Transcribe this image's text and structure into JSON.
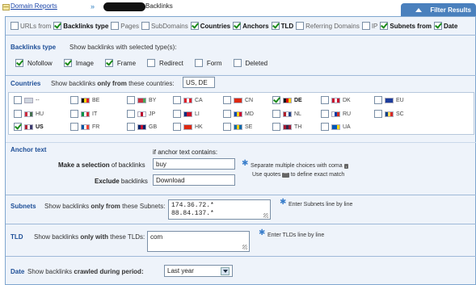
{
  "breadcrumb": {
    "root": "Domain Reports",
    "separator": "»",
    "current": "Backlinks"
  },
  "filter_tab": {
    "label": "Filter Results"
  },
  "columns": [
    {
      "label": "URLs from",
      "checked": false,
      "bold": false
    },
    {
      "label": "Backlinks type",
      "checked": true,
      "bold": true
    },
    {
      "label": "Pages",
      "checked": false,
      "bold": false
    },
    {
      "label": "SubDomains",
      "checked": false,
      "bold": false
    },
    {
      "label": "Countries",
      "checked": true,
      "bold": true
    },
    {
      "label": "Anchors",
      "checked": true,
      "bold": true
    },
    {
      "label": "TLD",
      "checked": true,
      "bold": true
    },
    {
      "label": "Referring Domains",
      "checked": false,
      "bold": false
    },
    {
      "label": "IP",
      "checked": false,
      "bold": false
    },
    {
      "label": "Subnets from",
      "checked": true,
      "bold": true
    },
    {
      "label": "Date",
      "checked": true,
      "bold": true
    }
  ],
  "backlinks_type": {
    "title": "Backlinks type",
    "description": "Show backlinks with selected type(s):",
    "options": [
      {
        "label": "Nofollow",
        "checked": true
      },
      {
        "label": "Image",
        "checked": true
      },
      {
        "label": "Frame",
        "checked": true
      },
      {
        "label": "Redirect",
        "checked": false
      },
      {
        "label": "Form",
        "checked": false
      },
      {
        "label": "Deleted",
        "checked": false
      }
    ]
  },
  "countries": {
    "title": "Countries",
    "desc_prefix": "Show backlinks",
    "desc_bold": "only from",
    "desc_suffix": "these countries:",
    "value": "US, DE",
    "items": [
      {
        "code": "--",
        "checked": false,
        "flag": [
          "#cfd6e0",
          "#cfd6e0",
          "#cfd6e0"
        ]
      },
      {
        "code": "BE",
        "checked": false,
        "flag": [
          "#111",
          "#f5d400",
          "#e0202a"
        ]
      },
      {
        "code": "BY",
        "checked": false,
        "flag": [
          "#c8313e",
          "#c8313e",
          "#4aa657"
        ]
      },
      {
        "code": "CA",
        "checked": false,
        "flag": [
          "#e0202a",
          "#fff",
          "#e0202a"
        ]
      },
      {
        "code": "CN",
        "checked": false,
        "flag": [
          "#de2910",
          "#de2910",
          "#de2910"
        ]
      },
      {
        "code": "DE",
        "checked": true,
        "flag": [
          "#111",
          "#dd0000",
          "#ffce00"
        ]
      },
      {
        "code": "DK",
        "checked": false,
        "flag": [
          "#c8102e",
          "#fff",
          "#c8102e"
        ]
      },
      {
        "code": "EU",
        "checked": false,
        "flag": [
          "#1c3c9c",
          "#1c3c9c",
          "#1c3c9c"
        ]
      },
      {
        "code": "HU",
        "checked": false,
        "flag": [
          "#cd2a3e",
          "#fff",
          "#436f4d"
        ]
      },
      {
        "code": "IT",
        "checked": false,
        "flag": [
          "#009246",
          "#fff",
          "#ce2b37"
        ]
      },
      {
        "code": "JP",
        "checked": false,
        "flag": [
          "#fff",
          "#bc002d",
          "#fff"
        ]
      },
      {
        "code": "LI",
        "checked": false,
        "flag": [
          "#002b7f",
          "#ce1126",
          "#ce1126"
        ]
      },
      {
        "code": "MD",
        "checked": false,
        "flag": [
          "#0046ae",
          "#ffd200",
          "#cc092f"
        ]
      },
      {
        "code": "NL",
        "checked": false,
        "flag": [
          "#ae1c28",
          "#fff",
          "#21468b"
        ]
      },
      {
        "code": "RU",
        "checked": false,
        "flag": [
          "#fff",
          "#0039a6",
          "#d52b1e"
        ]
      },
      {
        "code": "SC",
        "checked": false,
        "flag": [
          "#003f87",
          "#fcd856",
          "#d62828"
        ]
      },
      {
        "code": "US",
        "checked": true,
        "flag": [
          "#b22234",
          "#fff",
          "#3c3b6e"
        ]
      },
      {
        "code": "FR",
        "checked": false,
        "flag": [
          "#0055a4",
          "#fff",
          "#ef4135"
        ]
      },
      {
        "code": "GB",
        "checked": false,
        "flag": [
          "#012169",
          "#c8102e",
          "#012169"
        ]
      },
      {
        "code": "HK",
        "checked": false,
        "flag": [
          "#de2910",
          "#de2910",
          "#de2910"
        ]
      },
      {
        "code": "SE",
        "checked": false,
        "flag": [
          "#006aa7",
          "#fecc00",
          "#006aa7"
        ]
      },
      {
        "code": "TH",
        "checked": false,
        "flag": [
          "#a51931",
          "#2d2a4a",
          "#a51931"
        ]
      },
      {
        "code": "UA",
        "checked": false,
        "flag": [
          "#0057b7",
          "#0057b7",
          "#ffd700"
        ]
      }
    ]
  },
  "anchor": {
    "title": "Anchor text",
    "heading": "if anchor text contains:",
    "make_prefix": "Make a selection",
    "make_suffix": "of backlinks",
    "make_value": "buy",
    "exclude_prefix": "Exclude",
    "exclude_suffix": "backlinks",
    "exclude_value": "Download",
    "hint1_prefix": "Separate multiple choices with coma",
    "hint1_key": ",",
    "hint2_prefix": "Use quotes",
    "hint2_key": "\"\"",
    "hint2_suffix": "to define exact match"
  },
  "subnets": {
    "title": "Subnets",
    "desc_prefix": "Show backlinks",
    "desc_bold": "only from",
    "desc_suffix": "these Subnets:",
    "value": "174.36.72.*\n88.84.137.*",
    "hint": "Enter Subnets line by line"
  },
  "tld": {
    "title": "TLD",
    "desc_prefix": "Show backlinks",
    "desc_bold": "only with",
    "desc_suffix": "these TLDs:",
    "value": "com",
    "hint": "Enter TLDs line by line"
  },
  "date": {
    "title": "Date",
    "desc_prefix": "Show backlinks",
    "desc_bold": "crawled during period:",
    "value": "Last year"
  },
  "colors": {
    "accent": "#4a80bd",
    "section_title": "#1d4e97",
    "panel_bg": "#eef3fa",
    "check": "#1a8a1a"
  }
}
